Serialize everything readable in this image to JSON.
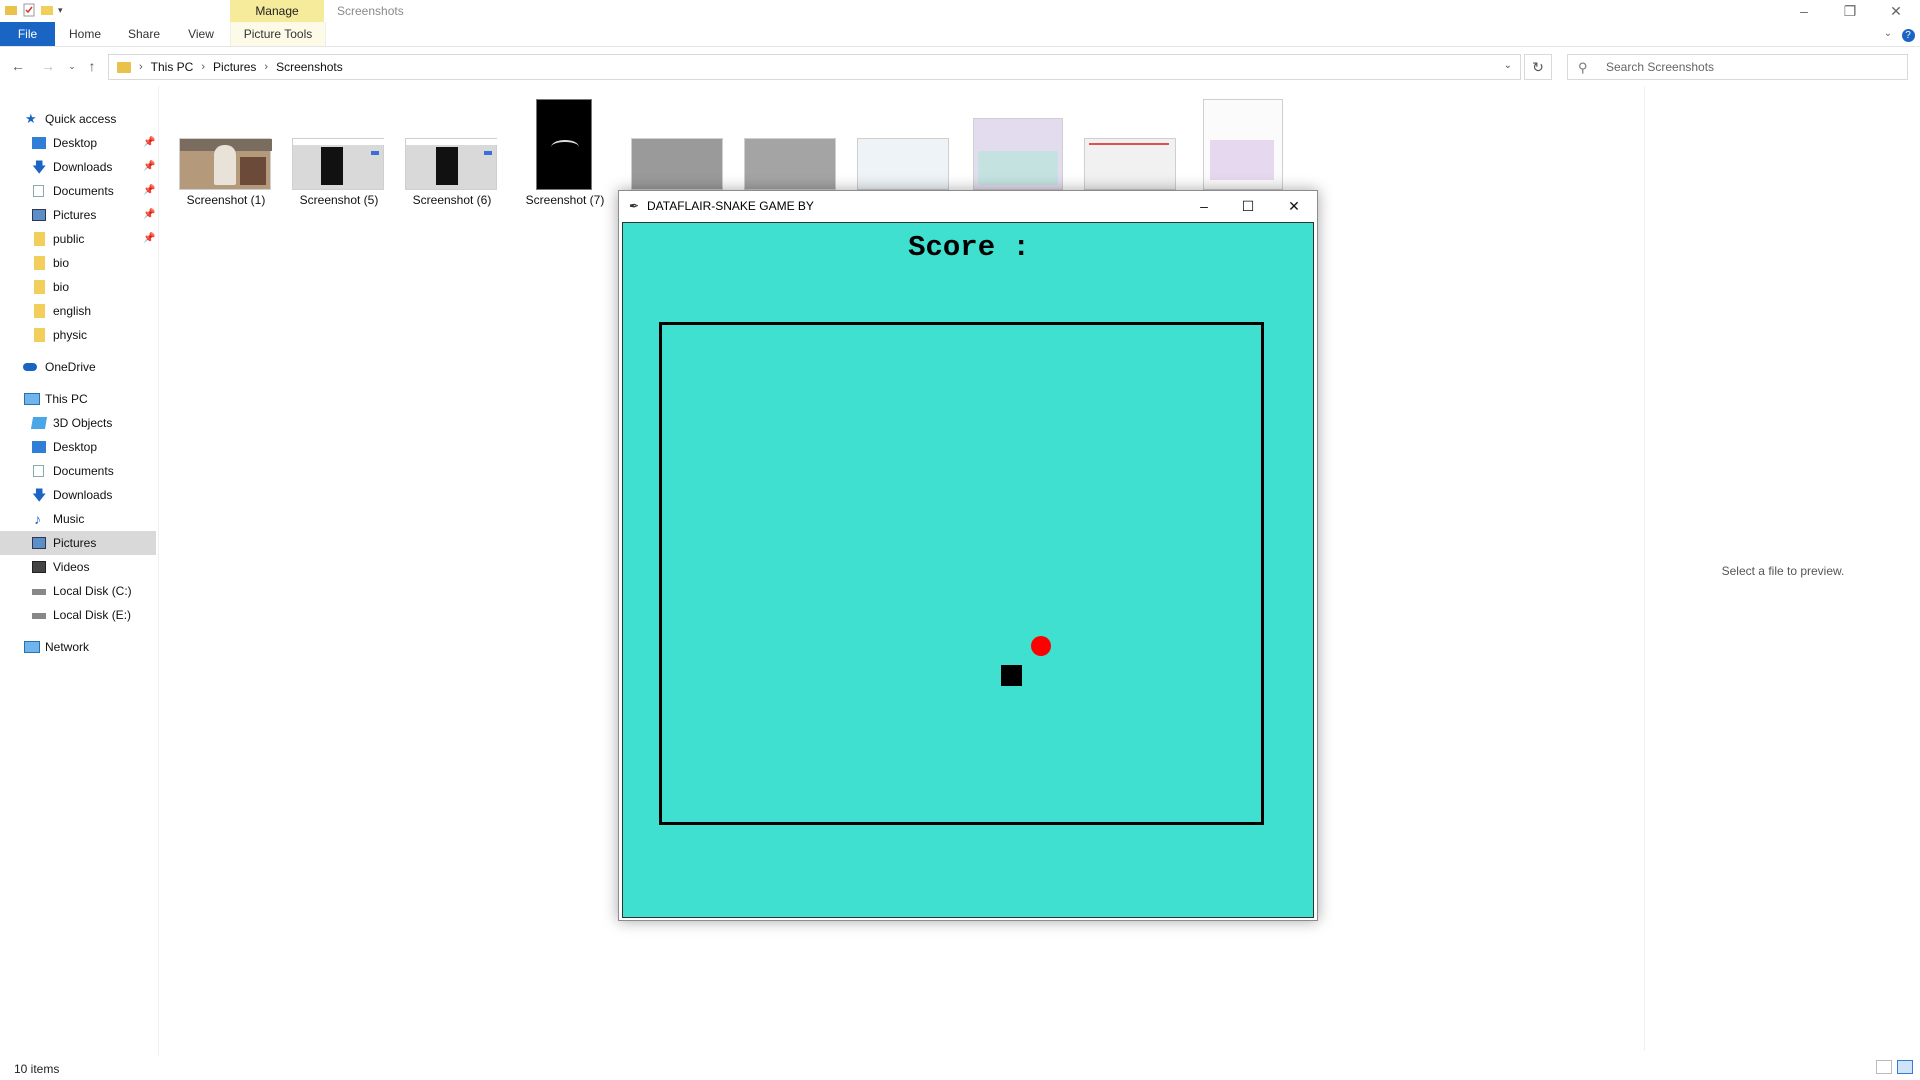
{
  "titlebar": {
    "manage_tab": "Manage",
    "window_title": "Screenshots"
  },
  "ribbon": {
    "tabs": [
      "File",
      "Home",
      "Share",
      "View",
      "Picture Tools"
    ]
  },
  "address": {
    "crumbs": [
      "This PC",
      "Pictures",
      "Screenshots"
    ],
    "search_placeholder": "Search Screenshots"
  },
  "nav": {
    "quick_access": "Quick access",
    "quick_items": [
      "Desktop",
      "Downloads",
      "Documents",
      "Pictures",
      "public",
      "bio",
      "bio",
      "english",
      "physic"
    ],
    "onedrive": "OneDrive",
    "this_pc": "This PC",
    "pc_items": [
      "3D Objects",
      "Desktop",
      "Documents",
      "Downloads",
      "Music",
      "Pictures",
      "Videos",
      "Local Disk (C:)",
      "Local Disk (E:)"
    ],
    "network": "Network",
    "selected": "Pictures"
  },
  "files": [
    {
      "name": "Screenshot (1)"
    },
    {
      "name": "Screenshot (5)"
    },
    {
      "name": "Screenshot (6)"
    },
    {
      "name": "Screenshot (7)"
    }
  ],
  "preview": {
    "message": "Select a file to preview."
  },
  "status": {
    "item_count": "10 items"
  },
  "game": {
    "title": "DATAFLAIR-SNAKE GAME BY",
    "score_label": "Score :",
    "colors": {
      "background": "#40e0d0",
      "food": "#ff0000",
      "snake": "#000000",
      "border": "#000000"
    }
  },
  "colors": {
    "file_tab": "#1a64c4",
    "manage_tab": "#f5eb9a",
    "selected_nav": "#d9d9d9"
  }
}
